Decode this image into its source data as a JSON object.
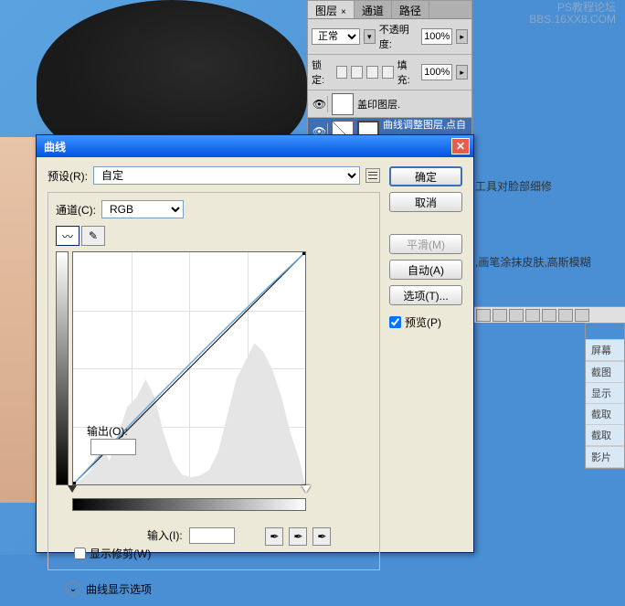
{
  "watermark": {
    "line1": "PS教程论坛",
    "line2": "BBS.16XX8.COM"
  },
  "panel": {
    "tabs": [
      "图层",
      "通道",
      "路径"
    ],
    "close_glyph": "×",
    "blend_mode": "正常",
    "opacity_label": "不透明度:",
    "opacity_value": "100%",
    "lock_label": "锁定:",
    "fill_label": "填充:",
    "fill_value": "100%",
    "layers": [
      {
        "name": "盖印图层.",
        "selected": false
      },
      {
        "name": "曲线调整图层,点自动选项",
        "selected": true
      }
    ]
  },
  "side_text": {
    "t1": "工具对脸部细修",
    "t2": ",画笔涂抹皮肤,高斯模糊"
  },
  "side_menu": {
    "items": [
      "屏幕",
      "截图",
      "显示",
      "截取",
      "截取",
      "影片"
    ]
  },
  "dialog": {
    "title": "曲线",
    "preset_label": "预设(R):",
    "preset_value": "自定",
    "channel_label": "通道(C):",
    "channel_value": "RGB",
    "output_label": "输出(O):",
    "input_label": "输入(I):",
    "show_clip_label": "显示修剪(W)",
    "expand_label": "曲线显示选项",
    "buttons": {
      "ok": "确定",
      "cancel": "取消",
      "smooth": "平滑(M)",
      "auto": "自动(A)",
      "options": "选项(T)..."
    },
    "preview_label": "预览(P)"
  }
}
